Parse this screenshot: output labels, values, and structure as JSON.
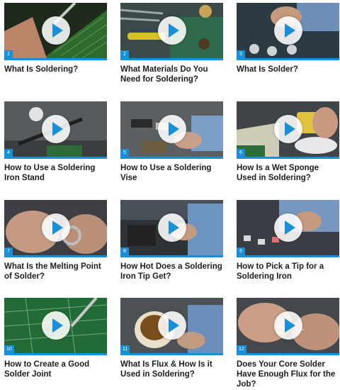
{
  "videos": [
    {
      "num": "1",
      "title": "What Is Soldering?",
      "scene": "pcb"
    },
    {
      "num": "2",
      "title": "What Materials Do You Need for Soldering?",
      "scene": "tools"
    },
    {
      "num": "3",
      "title": "What Is Solder?",
      "scene": "hands-blue"
    },
    {
      "num": "4",
      "title": "How to Use a Soldering Iron Stand",
      "scene": "stand"
    },
    {
      "num": "5",
      "title": "How to Use a Soldering Vise",
      "scene": "vise"
    },
    {
      "num": "6",
      "title": "How Is a Wet Sponge Used in Soldering?",
      "scene": "sponge"
    },
    {
      "num": "7",
      "title": "What Is the Melting Point of Solder?",
      "scene": "hands-close"
    },
    {
      "num": "8",
      "title": "How Hot Does a Soldering Iron Tip Get?",
      "scene": "hands-blue"
    },
    {
      "num": "9",
      "title": "How to Pick a Tip for a Soldering Iron",
      "scene": "tips"
    },
    {
      "num": "10",
      "title": "How to Create a Good Solder Joint",
      "scene": "pcb-green"
    },
    {
      "num": "11",
      "title": "What Is Flux & How Is it Used in Soldering?",
      "scene": "flux"
    },
    {
      "num": "12",
      "title": "Does Your Core Solder Have Enough Flux for the Job?",
      "scene": "hands-close"
    }
  ],
  "colors": {
    "accent": "#1b8fd6",
    "title_text": "#1d1d1d"
  }
}
